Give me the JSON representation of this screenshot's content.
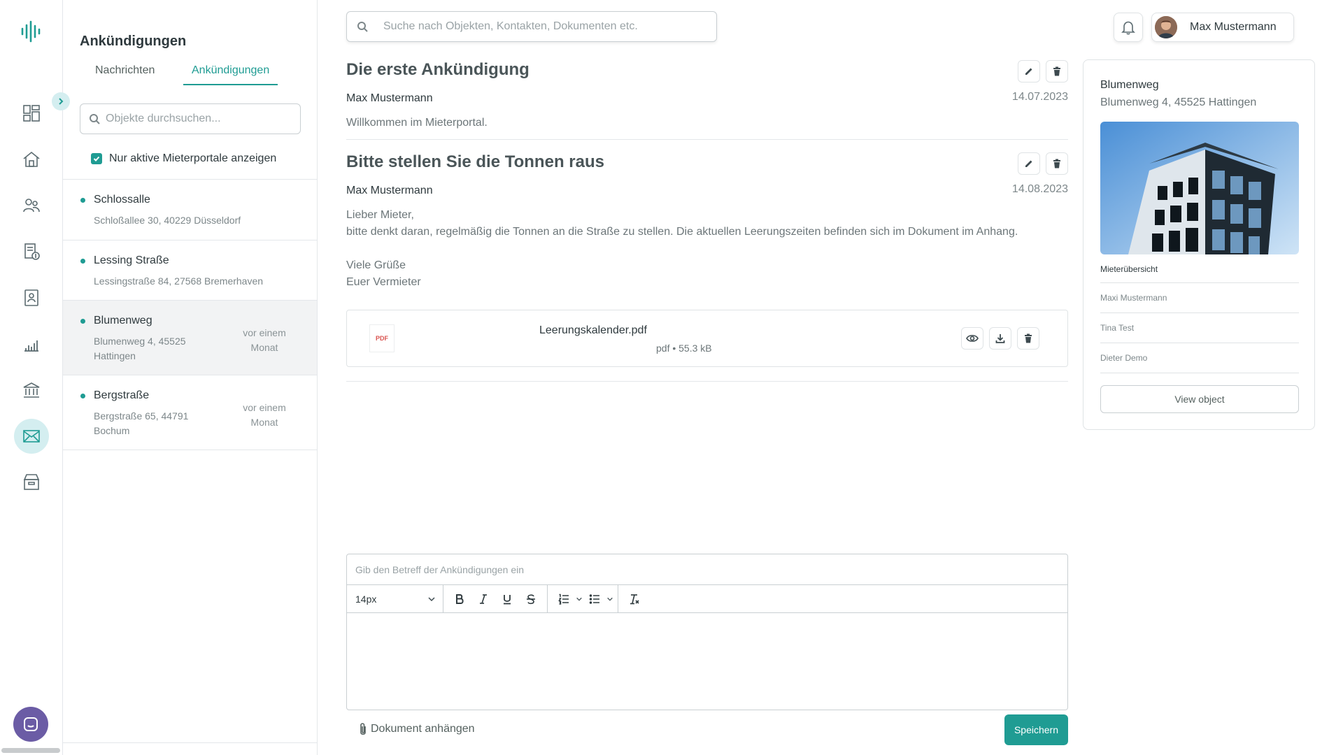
{
  "rail": {
    "logo_icon": "logo-waveform-icon",
    "items": [
      {
        "icon": "dashboard-icon"
      },
      {
        "icon": "home-icon"
      },
      {
        "icon": "contacts-icon"
      },
      {
        "icon": "billing-icon"
      },
      {
        "icon": "tenant-book-icon"
      },
      {
        "icon": "statistics-icon"
      },
      {
        "icon": "bank-icon"
      },
      {
        "icon": "mail-icon",
        "active": true
      },
      {
        "icon": "archive-icon"
      }
    ],
    "accent": "#1f9c93"
  },
  "panel": {
    "title": "Ankündigungen",
    "tabs": [
      {
        "label": "Nachrichten"
      },
      {
        "label": "Ankündigungen",
        "active": true
      }
    ],
    "search_placeholder": "Objekte durchsuchen...",
    "filter_label": "Nur aktive Mieterportale anzeigen",
    "filter_checked": true,
    "items": [
      {
        "name": "Schlossalle",
        "address": "Schloßallee 30, 40229 Düsseldorf",
        "time": ""
      },
      {
        "name": "Lessing Straße",
        "address": "Lessingstraße 84, 27568 Bremerhaven",
        "time": ""
      },
      {
        "name": "Blumenweg",
        "address": "Blumenweg 4, 45525 Hattingen",
        "time": "vor einem Monat",
        "selected": true
      },
      {
        "name": "Bergstraße",
        "address": "Bergstraße 65, 44791 Bochum",
        "time": "vor einem Monat"
      }
    ]
  },
  "header": {
    "search_placeholder": "Suche nach Objekten, Kontakten, Dokumenten etc.",
    "user_name": "Max Mustermann"
  },
  "announcements": [
    {
      "title": "Die erste Ankündigung",
      "author": "Max Mustermann",
      "date": "14.07.2023",
      "body": [
        "Willkommen im Mieterportal."
      ]
    },
    {
      "title": "Bitte stellen Sie die Tonnen raus",
      "author": "Max Mustermann",
      "date": "14.08.2023",
      "body": [
        "Lieber Mieter,",
        "bitte denkt daran, regelmäßig die Tonnen an die Straße zu stellen. Die aktuellen Leerungszeiten befinden sich im Dokument im Anhang.",
        "",
        "Viele Grüße",
        "Euer Vermieter"
      ],
      "attachment": {
        "thumb_label": "PDF",
        "file_name": "Leerungskalender.pdf",
        "meta": "pdf • 55.3 kB"
      }
    }
  ],
  "composer": {
    "subject_placeholder": "Gib den Betreff der Ankündigungen ein",
    "font_size": "14px",
    "attach_label": "Dokument anhängen",
    "save_label": "Speichern"
  },
  "object_card": {
    "name": "Blumenweg",
    "address": "Blumenweg 4, 45525 Hattingen",
    "section_title": "Mieterübersicht",
    "tenants": [
      "Maxi Mustermann",
      "Tina Test",
      "Dieter Demo"
    ],
    "view_label": "View object"
  }
}
